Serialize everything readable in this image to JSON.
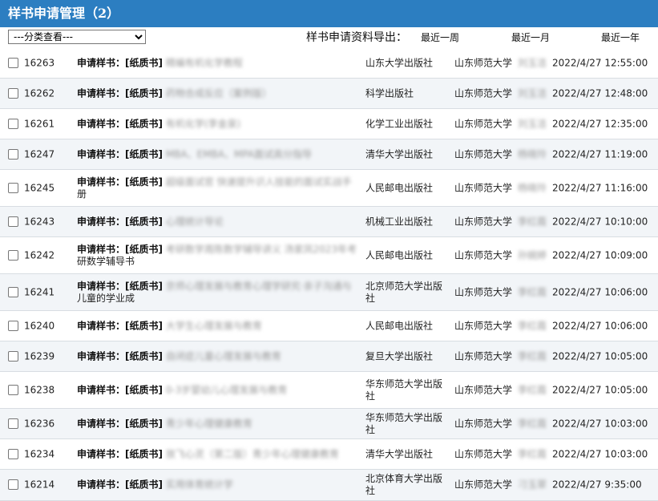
{
  "header": {
    "title": "样书申请管理（2）"
  },
  "toolbar": {
    "filter_selected": "---分类查看---",
    "export_label": "样书申请资料导出：",
    "range_week": "最近一周",
    "range_month": "最近一月",
    "range_year": "最近一年"
  },
  "row_labels": {
    "apply": "申请样书：",
    "type": "[纸质书]"
  },
  "rows": [
    {
      "id": "16263",
      "book": "精编有机化学教程",
      "book_tail": "",
      "publisher": "山东大学出版社",
      "university": "山东师范大学",
      "person": "刘玉洁",
      "date": "2022/4/27 12:55:00"
    },
    {
      "id": "16262",
      "book": "药物合成反应（案例版）",
      "book_tail": "",
      "publisher": "科学出版社",
      "university": "山东师范大学",
      "person": "刘玉洁",
      "date": "2022/4/27 12:48:00"
    },
    {
      "id": "16261",
      "book": "有机化学(李金泉)",
      "book_tail": "",
      "publisher": "化学工业出版社",
      "university": "山东师范大学",
      "person": "刘玉洁",
      "date": "2022/4/27 12:35:00"
    },
    {
      "id": "16247",
      "book": "MBA、EMBA、MPA面试高分指导",
      "book_tail": "",
      "publisher": "清华大学出版社",
      "university": "山东师范大学",
      "person": "杨晓玲",
      "date": "2022/4/27 11:19:00"
    },
    {
      "id": "16245",
      "book": "超级面试官 快速提升识人技能的面试实战手",
      "book_tail": "册",
      "publisher": "人民邮电出版社",
      "university": "山东师范大学",
      "person": "杨晓玲",
      "date": "2022/4/27 11:16:00"
    },
    {
      "id": "16243",
      "book": "心理统计导论",
      "book_tail": "",
      "publisher": "机械工业出版社",
      "university": "山东师范大学",
      "person": "李红霞",
      "date": "2022/4/27 10:10:00"
    },
    {
      "id": "16242",
      "book": "考研数学周陈数学辅导讲义 汤家凤2023年考",
      "book_tail": "研数学辅导书",
      "publisher": "人民邮电出版社",
      "university": "山东师范大学",
      "person": "孙婉婷",
      "date": "2022/4/27 10:09:00"
    },
    {
      "id": "16241",
      "book": "京师心理发展与教育心理学研究·亲子沟通与",
      "book_tail": "儿童的学业成",
      "publisher": "北京师范大学出版社",
      "university": "山东师范大学",
      "person": "李红霞",
      "date": "2022/4/27 10:06:00"
    },
    {
      "id": "16240",
      "book": "大学生心理发展与教育",
      "book_tail": "",
      "publisher": "人民邮电出版社",
      "university": "山东师范大学",
      "person": "李红霞",
      "date": "2022/4/27 10:06:00"
    },
    {
      "id": "16239",
      "book": "自闭症儿童心理发展与教育",
      "book_tail": "",
      "publisher": "复旦大学出版社",
      "university": "山东师范大学",
      "person": "李红霞",
      "date": "2022/4/27 10:05:00"
    },
    {
      "id": "16238",
      "book": "0-3岁婴幼儿心理发展与教育",
      "book_tail": "",
      "publisher": "华东师范大学出版社",
      "university": "山东师范大学",
      "person": "李红霞",
      "date": "2022/4/27 10:05:00"
    },
    {
      "id": "16236",
      "book": "青少年心理健康教育",
      "book_tail": "",
      "publisher": "华东师范大学出版社",
      "university": "山东师范大学",
      "person": "李红霞",
      "date": "2022/4/27 10:03:00"
    },
    {
      "id": "16234",
      "book": "放飞心灵（第二版）青少年心理健康教育",
      "book_tail": "",
      "publisher": "清华大学出版社",
      "university": "山东师范大学",
      "person": "李红霞",
      "date": "2022/4/27 10:03:00"
    },
    {
      "id": "16214",
      "book": "实用体育统计学",
      "book_tail": "",
      "publisher": "北京体育大学出版社",
      "university": "山东师范大学",
      "person": "刁玉翠",
      "date": "2022/4/27 9:35:00"
    }
  ]
}
